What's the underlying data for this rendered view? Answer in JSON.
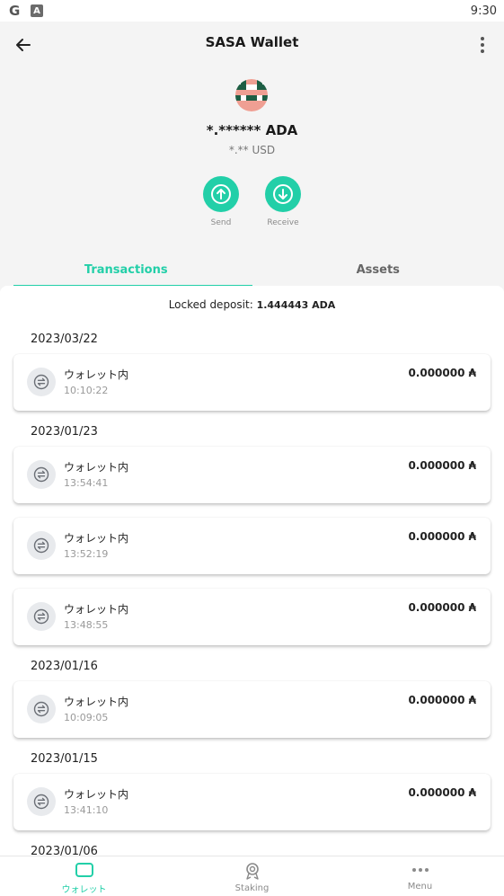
{
  "status_bar": {
    "time": "9:30",
    "g_glyph": "G",
    "a_glyph": "A"
  },
  "header": {
    "title": "SASA Wallet",
    "balance": "*.****** ADA",
    "fiat": "*.** USD",
    "send_label": "Send",
    "receive_label": "Receive"
  },
  "tabs": [
    {
      "label": "Transactions",
      "active": true
    },
    {
      "label": "Assets",
      "active": false
    }
  ],
  "locked": {
    "label": "Locked deposit:",
    "value": "1.444443 ADA"
  },
  "groups": [
    {
      "date": "2023/03/22",
      "items": [
        {
          "name": "ウォレット内",
          "time": "10:10:22",
          "amount": "0.000000 ₳"
        }
      ]
    },
    {
      "date": "2023/01/23",
      "items": [
        {
          "name": "ウォレット内",
          "time": "13:54:41",
          "amount": "0.000000 ₳"
        },
        {
          "name": "ウォレット内",
          "time": "13:52:19",
          "amount": "0.000000 ₳"
        },
        {
          "name": "ウォレット内",
          "time": "13:48:55",
          "amount": "0.000000 ₳"
        }
      ]
    },
    {
      "date": "2023/01/16",
      "items": [
        {
          "name": "ウォレット内",
          "time": "10:09:05",
          "amount": "0.000000 ₳"
        }
      ]
    },
    {
      "date": "2023/01/15",
      "items": [
        {
          "name": "ウォレット内",
          "time": "13:41:10",
          "amount": "0.000000 ₳"
        }
      ]
    },
    {
      "date": "2023/01/06",
      "items": []
    }
  ],
  "nav": [
    {
      "label": "ウォレット",
      "icon": "wallet-icon",
      "active": true
    },
    {
      "label": "Staking",
      "icon": "staking-icon",
      "active": false
    },
    {
      "label": "Menu",
      "icon": "more-dots-icon",
      "active": false
    }
  ],
  "colors": {
    "accent": "#22cfa8"
  }
}
